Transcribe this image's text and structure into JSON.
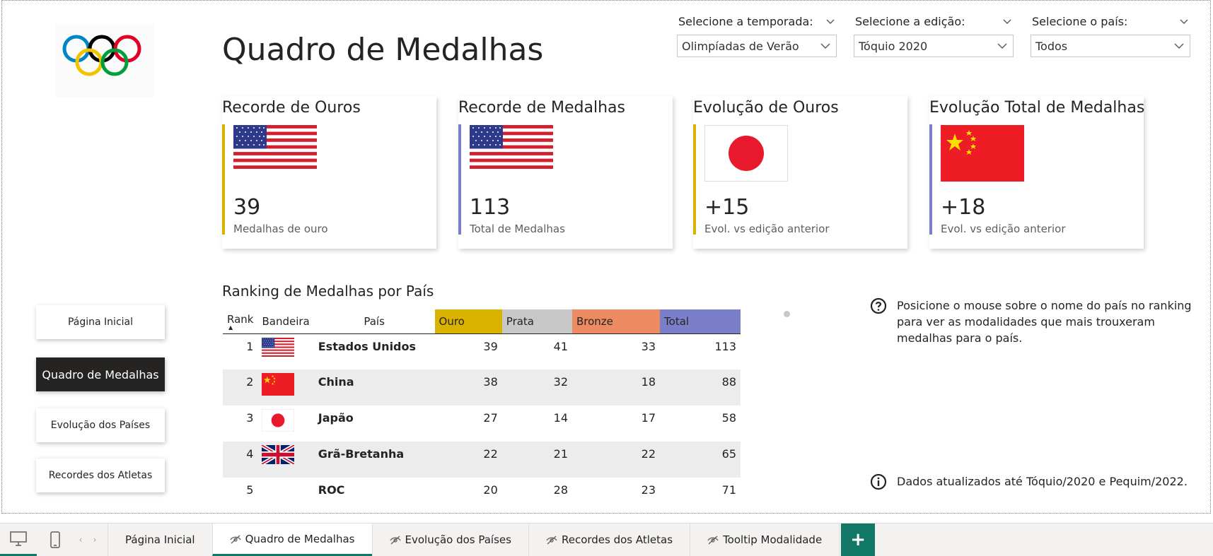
{
  "page": {
    "title": "Quadro de Medalhas"
  },
  "slicers": [
    {
      "label": "Selecione a temporada:",
      "value": "Olimpíadas de Verão"
    },
    {
      "label": "Selecione a edição:",
      "value": "Tóquio 2020"
    },
    {
      "label": "Selecione o país:",
      "value": "Todos"
    }
  ],
  "cards": [
    {
      "title": "Recorde de Ouros",
      "flag": "usa-flag",
      "value": "39",
      "subtitle": "Medalhas de ouro",
      "accent": "#d9b300"
    },
    {
      "title": "Recorde de Medalhas",
      "flag": "usa-flag",
      "value": "113",
      "subtitle": "Total de Medalhas",
      "accent": "#7b7fc9"
    },
    {
      "title": "Evolução de Ouros",
      "flag": "japan-flag",
      "value": "+15",
      "subtitle": "Evol. vs edição anterior",
      "accent": "#d9b300"
    },
    {
      "title": "Evolução Total de Medalhas",
      "flag": "china-flag",
      "value": "+18",
      "subtitle": "Evol. vs edição anterior",
      "accent": "#7b7fc9"
    }
  ],
  "nav": [
    {
      "label": "Página Inicial",
      "active": false
    },
    {
      "label": "Quadro de Medalhas",
      "active": true
    },
    {
      "label": "Evolução dos Países",
      "active": false
    },
    {
      "label": "Recordes dos Atletas",
      "active": false
    }
  ],
  "table": {
    "title": "Ranking de Medalhas por País",
    "headers": {
      "rank": "Rank",
      "flag": "Bandeira",
      "country": "País",
      "gold": "Ouro",
      "silver": "Prata",
      "bronze": "Bronze",
      "total": "Total"
    },
    "header_colors": {
      "gold": "#d9b300",
      "silver": "#c8c8c8",
      "bronze": "#ec8b62",
      "total": "#7b7fc9"
    },
    "rows": [
      {
        "rank": "1",
        "flag": "usa-flag",
        "country": "Estados Unidos",
        "gold": "39",
        "silver": "41",
        "bronze": "33",
        "total": "113"
      },
      {
        "rank": "2",
        "flag": "china-flag",
        "country": "China",
        "gold": "38",
        "silver": "32",
        "bronze": "18",
        "total": "88"
      },
      {
        "rank": "3",
        "flag": "japan-flag",
        "country": "Japão",
        "gold": "27",
        "silver": "14",
        "bronze": "17",
        "total": "58"
      },
      {
        "rank": "4",
        "flag": "uk-flag",
        "country": "Grã-Bretanha",
        "gold": "22",
        "silver": "21",
        "bronze": "22",
        "total": "65"
      },
      {
        "rank": "5",
        "flag": "",
        "country": "ROC",
        "gold": "20",
        "silver": "28",
        "bronze": "23",
        "total": "71"
      }
    ]
  },
  "info": {
    "hover_hint": "Posicione o mouse sobre o nome do país no ranking para ver as modalidades que mais trouxeram medalhas para o país.",
    "updated_note": "Dados atualizados até Tóquio/2020 e Pequim/2022."
  },
  "tabs": [
    {
      "label": "Página Inicial",
      "hidden": false,
      "active": false
    },
    {
      "label": "Quadro de Medalhas",
      "hidden": true,
      "active": true
    },
    {
      "label": "Evolução dos Países",
      "hidden": true,
      "active": false
    },
    {
      "label": "Recordes dos Atletas",
      "hidden": true,
      "active": false
    },
    {
      "label": "Tooltip Modalidade",
      "hidden": true,
      "active": false
    }
  ],
  "add_tab_label": "+"
}
